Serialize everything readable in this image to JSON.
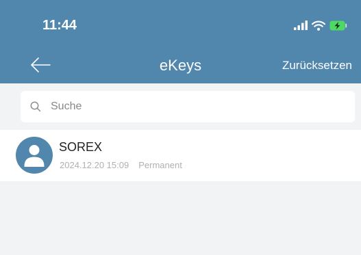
{
  "status_bar": {
    "time": "11:44"
  },
  "nav": {
    "title": "eKeys",
    "action_label": "Zurücksetzen",
    "back_icon": "arrow-left-icon"
  },
  "search": {
    "placeholder": "Suche",
    "value": ""
  },
  "ekeys": [
    {
      "name": "SOREX",
      "date": "2024.12.20 15:09",
      "validity": "Permanent"
    }
  ],
  "colors": {
    "header": "#5186ad",
    "background": "#f2f3f5",
    "avatar": "#5186ad"
  }
}
